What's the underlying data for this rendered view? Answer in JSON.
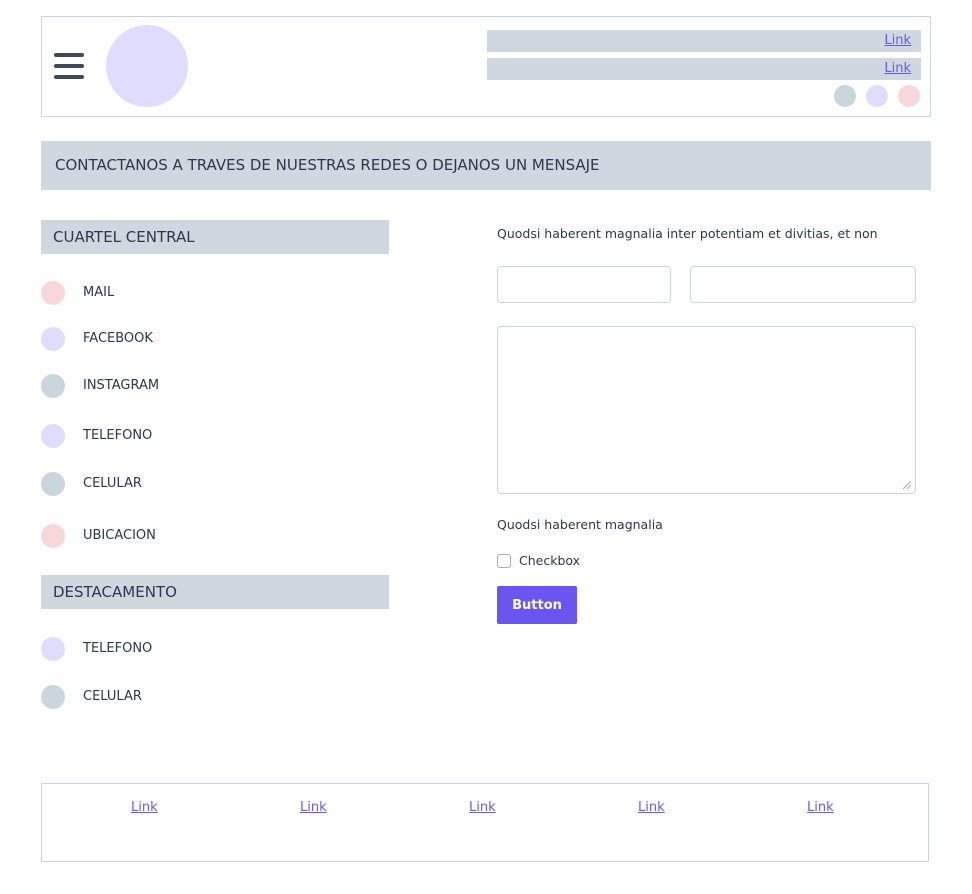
{
  "header": {
    "top_links": [
      "Link",
      "Link"
    ],
    "dot_colors": [
      "#cbd5dc",
      "#e0dcff",
      "#f8d7da"
    ]
  },
  "section": {
    "title": "CONTACTANOS A TRAVES DE NUESTRAS REDES O DEJANOS UN MENSAJE"
  },
  "cuartel": {
    "title": "CUARTEL CENTRAL",
    "items": [
      {
        "label": "MAIL",
        "color": "#f8d7da"
      },
      {
        "label": "FACEBOOK",
        "color": "#e0dcff"
      },
      {
        "label": "INSTAGRAM",
        "color": "#cbd5dc"
      },
      {
        "label": "TELEFONO",
        "color": "#e0dcff"
      },
      {
        "label": "CELULAR",
        "color": "#cbd5dc"
      },
      {
        "label": "UBICACION",
        "color": "#f8d7da"
      }
    ]
  },
  "destacamento": {
    "title": "DESTACAMENTO",
    "items": [
      {
        "label": "TELEFONO",
        "color": "#e0dcff"
      },
      {
        "label": "CELULAR",
        "color": "#cbd5dc"
      }
    ]
  },
  "form": {
    "intro": "Quodsi haberent magnalia inter potentiam et divitias, et non",
    "input1_value": "",
    "input2_value": "",
    "textarea_value": "",
    "note": "Quodsi haberent magnalia",
    "checkbox_label": "Checkbox",
    "button_label": "Button"
  },
  "footer": {
    "links": [
      "Link",
      "Link",
      "Link",
      "Link",
      "Link"
    ]
  },
  "colors": {
    "accent": "#6a55f0",
    "bar": "#cfd8e0",
    "border": "#cbd5e0"
  }
}
